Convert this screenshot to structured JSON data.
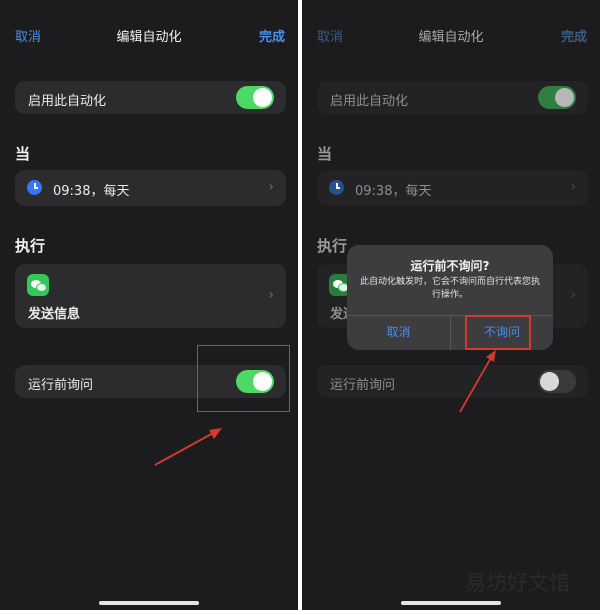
{
  "left_screen": {
    "nav": {
      "cancel": "取消",
      "title": "编辑自动化",
      "done": "完成"
    },
    "enable_row": {
      "label": "启用此自动化",
      "toggle_on": true
    },
    "when_section": {
      "title": "当",
      "trigger": "09:38，每天",
      "icon": "clock-icon"
    },
    "do_section": {
      "title": "执行",
      "action": "发送信息",
      "icon": "wechat-icon"
    },
    "ask_row": {
      "label": "运行前询问",
      "toggle_on": true
    }
  },
  "right_screen": {
    "nav": {
      "cancel": "取消",
      "title": "编辑自动化",
      "done": "完成"
    },
    "enable_row": {
      "label": "启用此自动化",
      "toggle_on": true
    },
    "when_section": {
      "title": "当",
      "trigger": "09:38，每天"
    },
    "do_section": {
      "title": "执行",
      "action": "发送"
    },
    "ask_row": {
      "label": "运行前询问",
      "toggle_on": false
    },
    "alert": {
      "title": "运行前不询问?",
      "message": "此自动化触发时，它会不询问而自行代表您执行操作。",
      "cancel": "取消",
      "confirm": "不询问"
    }
  },
  "watermark": "易坊好文馆",
  "colors": {
    "accent_blue": "#4a8fe8",
    "toggle_green": "#4cd964",
    "annotation_red": "#d23a2e"
  }
}
